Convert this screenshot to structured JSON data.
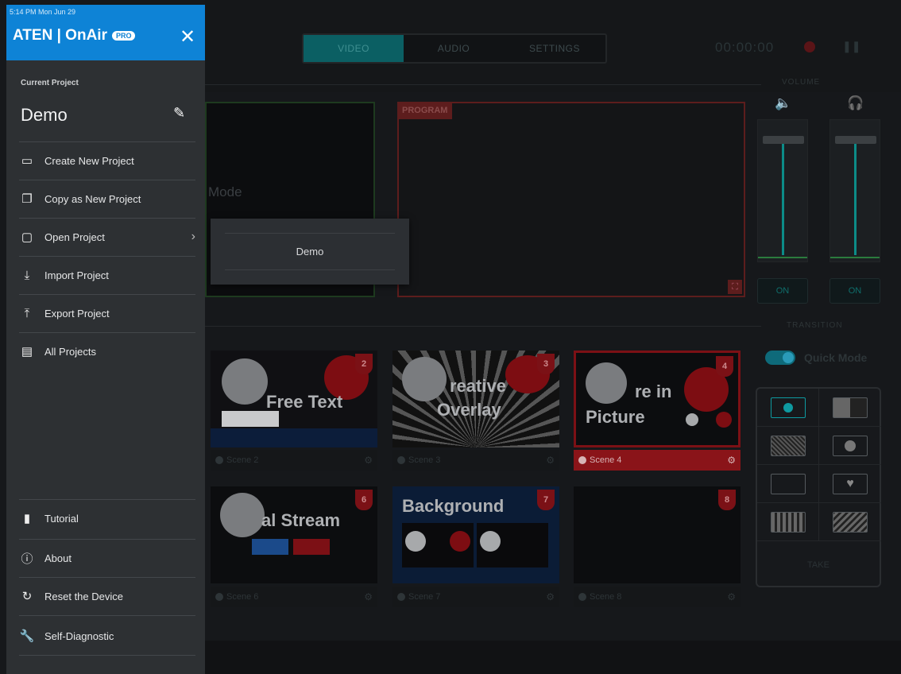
{
  "status_bar": {
    "time": "5:14 PM  Mon Jun 29"
  },
  "sidebar": {
    "brand": "ATEN | OnAir",
    "brand_badge": "PRO",
    "close_glyph": "✕",
    "current_project_label": "Current Project",
    "current_project_name": "Demo",
    "items": [
      {
        "label": "Create New Project",
        "icon": "new-icon"
      },
      {
        "label": "Copy as New Project",
        "icon": "copy-icon"
      },
      {
        "label": "Open Project",
        "icon": "folder-icon"
      },
      {
        "label": "Import Project",
        "icon": "import-icon"
      },
      {
        "label": "Export Project",
        "icon": "export-icon"
      },
      {
        "label": "All Projects",
        "icon": "clipboard-icon"
      }
    ],
    "bottom_items": [
      {
        "label": "Tutorial",
        "icon": "book-icon"
      },
      {
        "label": "About",
        "icon": "info-icon"
      },
      {
        "label": "Reset the Device",
        "icon": "reset-icon"
      },
      {
        "label": "Self-Diagnostic",
        "icon": "wrench-icon"
      }
    ]
  },
  "tabs": [
    "VIDEO",
    "AUDIO",
    "SETTINGS"
  ],
  "timecode": "00:00:00",
  "preview": {
    "mode_text": "Mode"
  },
  "program": {
    "label": "PROGRAM"
  },
  "popup": {
    "item": "Demo"
  },
  "volume": {
    "label": "VOLUME",
    "left_on": "ON",
    "right_on": "ON"
  },
  "transition": {
    "label": "TRANSITION",
    "quick_mode": "Quick Mode",
    "take": "TAKE"
  },
  "scenes": [
    {
      "num": "2",
      "title": "Free Text",
      "name": "Scene 2"
    },
    {
      "num": "3",
      "title": "reative",
      "title2": "Overlay",
      "name": "Scene 3"
    },
    {
      "num": "4",
      "title": "re in",
      "title2": "Picture",
      "name": "Scene 4"
    },
    {
      "num": "6",
      "title": "al Stream",
      "name": "Scene 6"
    },
    {
      "num": "7",
      "title": "Background",
      "name": "Scene 7"
    },
    {
      "num": "8",
      "title": "",
      "name": "Scene 8"
    }
  ],
  "colors": {
    "accent": "#0e83d6",
    "program_red": "#7c1015",
    "teal": "#0c8c88"
  }
}
